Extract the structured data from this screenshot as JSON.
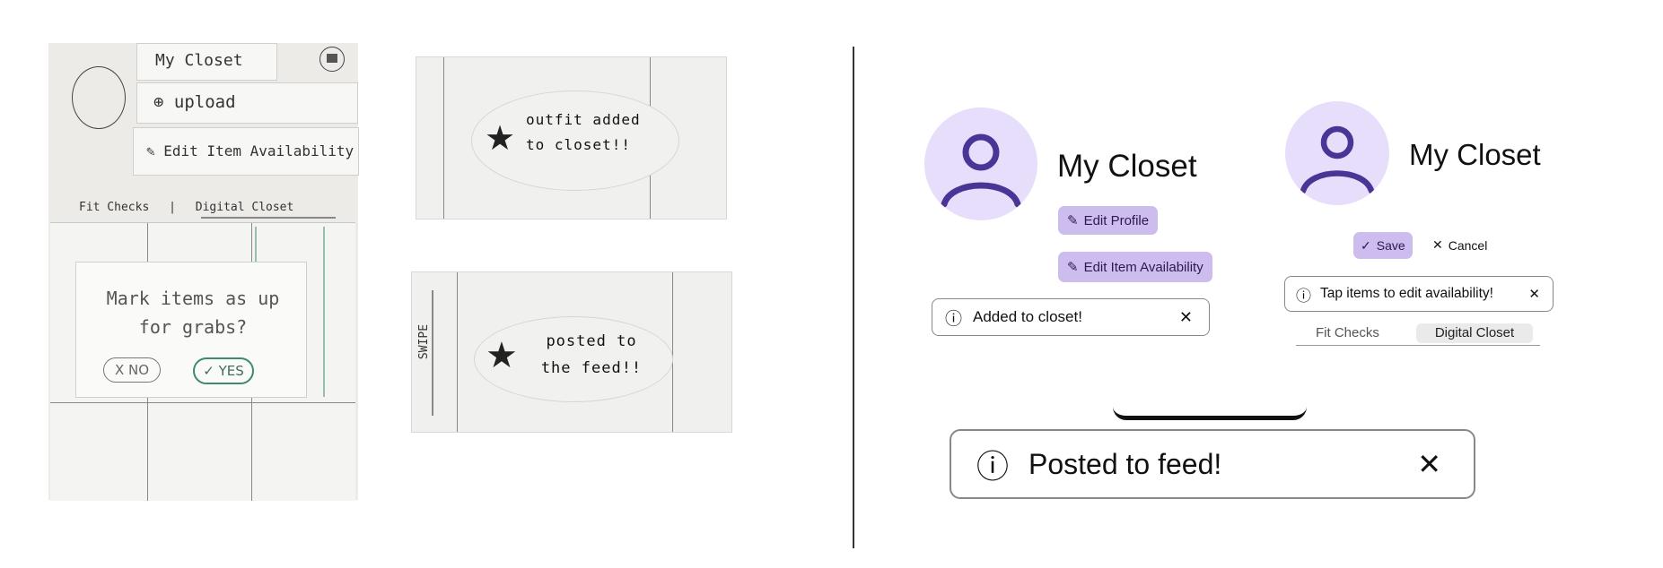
{
  "sketch": {
    "menu_my_closet": "My Closet",
    "menu_upload": "upload",
    "menu_edit_availability": "Edit Item Availability",
    "tab_fit_checks": "Fit Checks",
    "tab_digital_closet": "Digital Closet",
    "modal_text": "Mark items as up for grabs?",
    "btn_no": "X NO",
    "btn_yes": "✓ YES",
    "note_outfit": "outfit added to closet!!",
    "note_posted": "posted to the feed!!",
    "swipe_label": "SWIPE"
  },
  "screen1": {
    "title": "My Closet",
    "edit_profile": "Edit Profile",
    "edit_availability": "Edit Item Availability",
    "toast": "Added to closet!"
  },
  "screen2": {
    "title": "My Closet",
    "save": "Save",
    "cancel": "Cancel",
    "toast": "Tap items to edit availability!",
    "tab_fit_checks": "Fit Checks",
    "tab_digital_closet": "Digital Closet"
  },
  "screen3": {
    "toast": "Posted to feed!"
  },
  "colors": {
    "avatar_bg": "#e7defb",
    "avatar_fg": "#4a3596",
    "button_bg": "#cdbcee",
    "tab_active_bg": "#eaeaea"
  }
}
